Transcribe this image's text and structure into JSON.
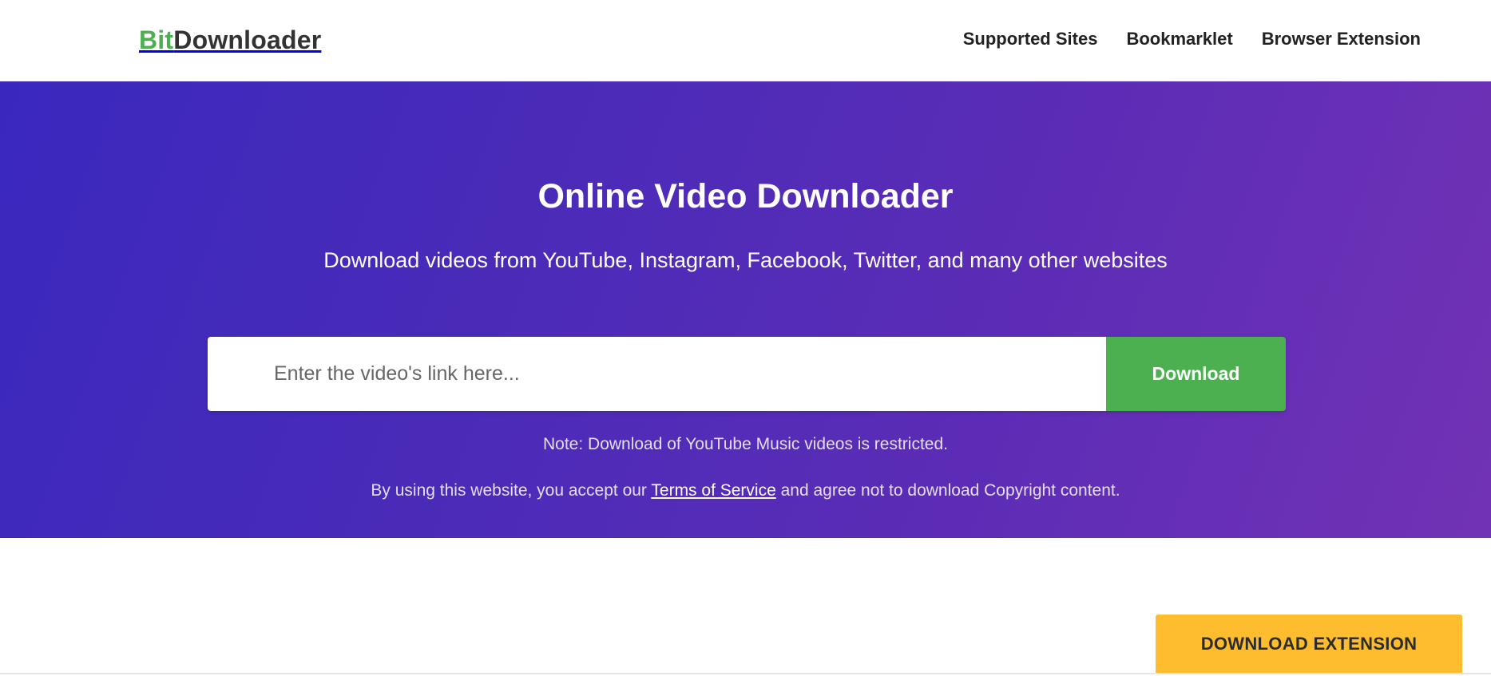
{
  "header": {
    "logo_part1": "Bit",
    "logo_part2": "Downloader",
    "nav": [
      {
        "label": "Supported Sites"
      },
      {
        "label": "Bookmarklet"
      },
      {
        "label": "Browser Extension"
      }
    ]
  },
  "hero": {
    "title": "Online Video Downloader",
    "subtitle": "Download videos from YouTube, Instagram, Facebook, Twitter, and many other websites",
    "search": {
      "placeholder": "Enter the video's link here...",
      "value": "",
      "button_label": "Download"
    },
    "note": "Note: Download of YouTube Music videos is restricted.",
    "terms": {
      "prefix": "By using this website, you accept our ",
      "link": "Terms of Service",
      "suffix": " and agree not to download Copyright content."
    }
  },
  "cta": {
    "extension_label": "DOWNLOAD EXTENSION"
  },
  "colors": {
    "brand_green": "#4caf50",
    "gradient_start": "#3a28be",
    "gradient_end": "#7232b5",
    "cta_yellow": "#fdbd2e"
  }
}
